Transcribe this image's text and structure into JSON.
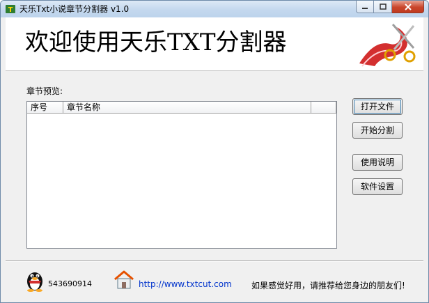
{
  "window": {
    "title": "天乐Txt小说章节分割器 v1.0"
  },
  "banner": {
    "title": "欢迎使用天乐TXT分割器"
  },
  "preview": {
    "label": "章节预览:",
    "columns": [
      "序号",
      "章节名称",
      ""
    ],
    "rows": []
  },
  "buttons": {
    "open_file": "打开文件",
    "start_split": "开始分割",
    "instructions": "使用说明",
    "settings": "软件设置"
  },
  "footer": {
    "qq_number": "543690914",
    "website": "http://www.txtcut.com",
    "promo": "如果感觉好用，请推荐给您身边的朋友们!"
  },
  "icons": {
    "app": "app-icon",
    "banner": "scissors-ribbon-icon",
    "qq": "qq-penguin-icon",
    "website": "house-icon"
  }
}
